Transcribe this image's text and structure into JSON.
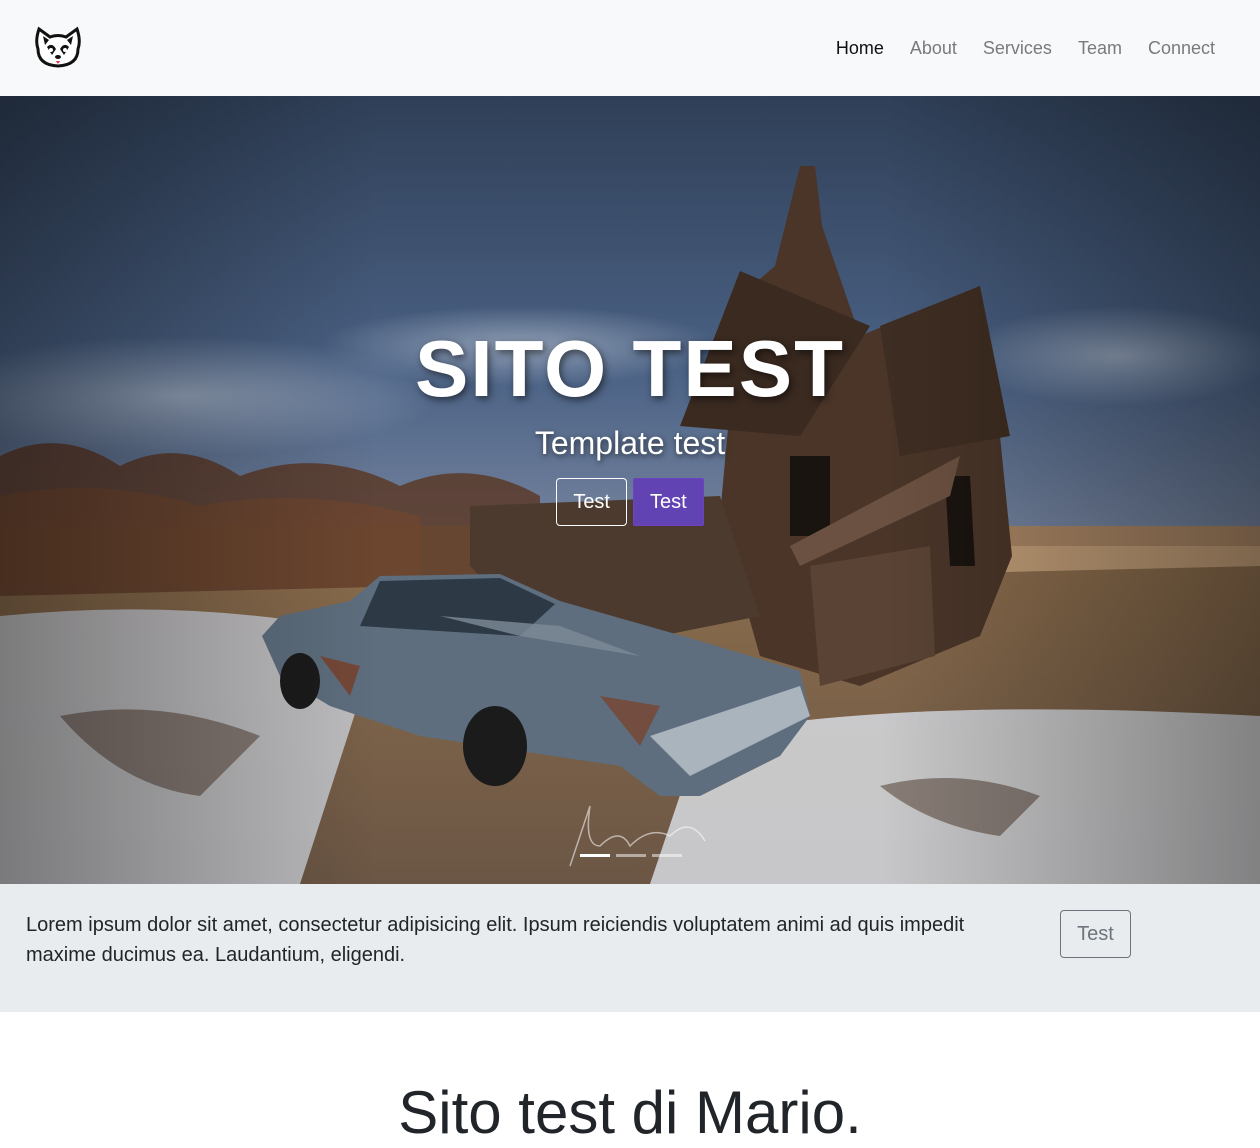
{
  "navbar": {
    "logo": "husky-logo-icon",
    "links": [
      {
        "label": "Home",
        "active": true
      },
      {
        "label": "About",
        "active": false
      },
      {
        "label": "Services",
        "active": false
      },
      {
        "label": "Team",
        "active": false
      },
      {
        "label": "Connect",
        "active": false
      }
    ]
  },
  "hero": {
    "title": "SITO TEST",
    "subtitle": "Template test",
    "buttons": {
      "outline_label": "Test",
      "primary_label": "Test"
    },
    "carousel": {
      "slide_count": 3,
      "active_index": 0
    },
    "image": "abandoned-house-and-rusty-car-in-snowy-prairie"
  },
  "info": {
    "text": "Lorem ipsum dolor sit amet, consectetur adipisicing elit. Ipsum reiciendis voluptatem animi ad quis impedit maxime ducimus ea. Laudantium, eligendi.",
    "button_label": "Test"
  },
  "section": {
    "title": "Sito test di Mario."
  },
  "colors": {
    "navbar_bg": "#f8f9fa",
    "accent": "#6243b4",
    "info_bg": "#e9ecef"
  }
}
